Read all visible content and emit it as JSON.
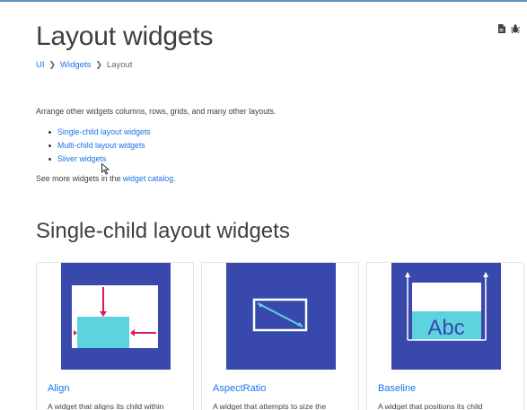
{
  "page": {
    "title": "Layout widgets",
    "breadcrumb": [
      "UI",
      "Widgets",
      "Layout"
    ],
    "intro": "Arrange other widgets columns, rows, grids, and many other layouts.",
    "links": [
      "Single-child layout widgets",
      "Multi-child layout widgets",
      "Sliver widgets"
    ],
    "more_prefix": "See more widgets in the ",
    "more_link": "widget catalog",
    "more_suffix": "."
  },
  "section": {
    "title": "Single-child layout widgets"
  },
  "cards": [
    {
      "name": "Align",
      "desc": "A widget that aligns its child within"
    },
    {
      "name": "AspectRatio",
      "desc": "A widget that attempts to size the"
    },
    {
      "name": "Baseline",
      "desc": "A widget that positions its child",
      "image_text": "Abc"
    }
  ],
  "icons": {
    "top_right": [
      "document-icon",
      "bug-icon"
    ]
  },
  "colors": {
    "link": "#1a73e8",
    "card_image_bg": "#3949ab",
    "accent_cyan": "#5dd3e0",
    "arrow_pink": "#d81b60"
  }
}
